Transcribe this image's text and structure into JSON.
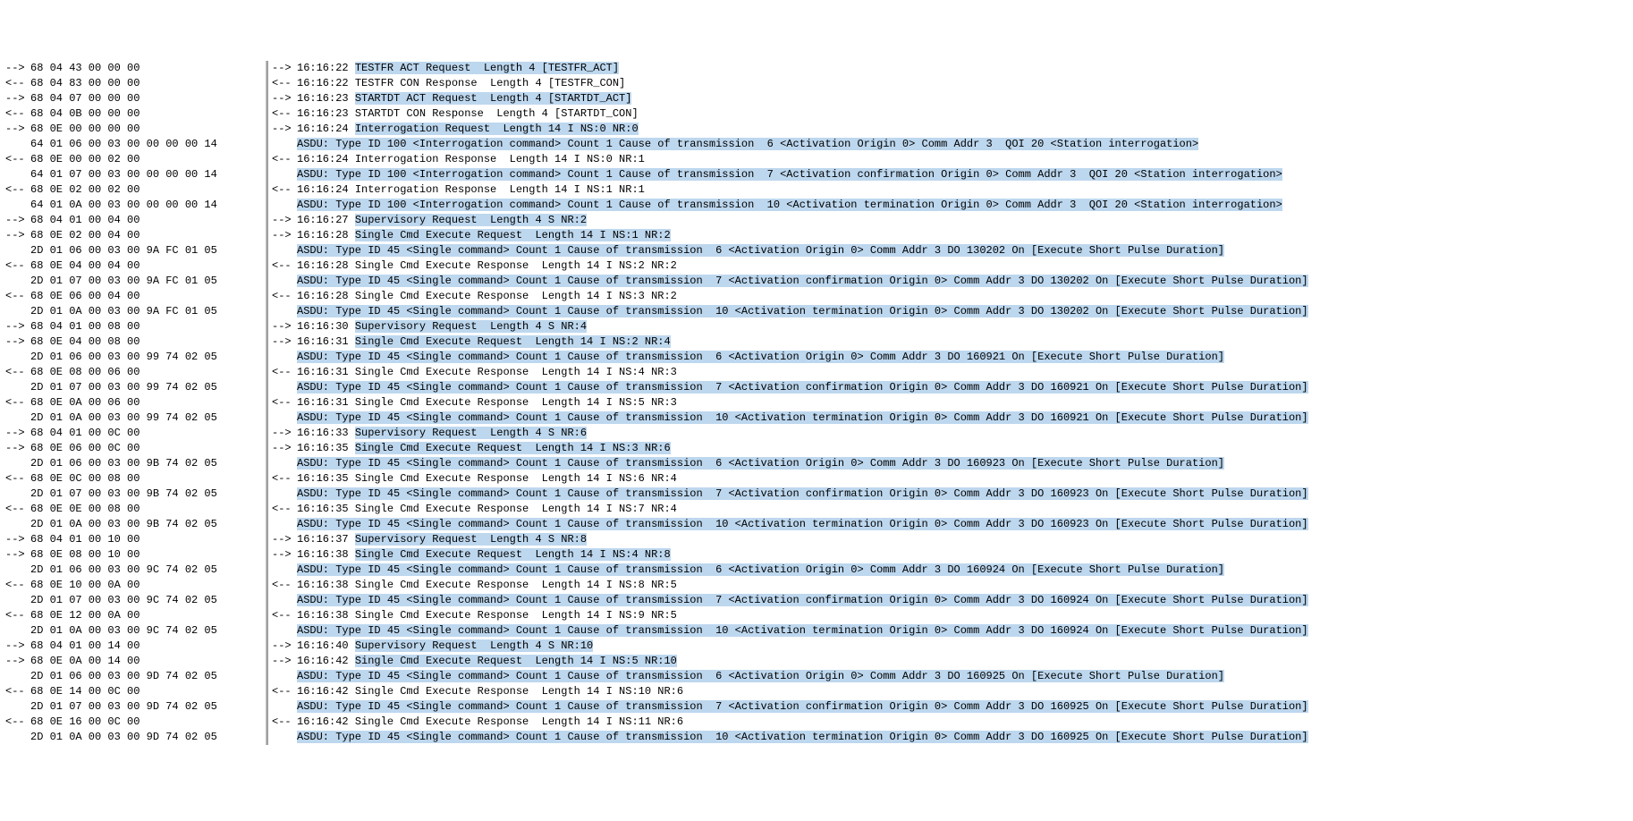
{
  "left": [
    {
      "dir": "-->",
      "hex": "68 04 43 00 00 00"
    },
    {
      "dir": "<--",
      "hex": "68 04 83 00 00 00"
    },
    {
      "dir": "-->",
      "hex": "68 04 07 00 00 00"
    },
    {
      "dir": "<--",
      "hex": "68 04 0B 00 00 00"
    },
    {
      "dir": "-->",
      "hex": "68 0E 00 00 00 00"
    },
    {
      "dir": "   ",
      "hex": "64 01 06 00 03 00 00 00 00 14"
    },
    {
      "dir": "<--",
      "hex": "68 0E 00 00 02 00"
    },
    {
      "dir": "   ",
      "hex": "64 01 07 00 03 00 00 00 00 14"
    },
    {
      "dir": "<--",
      "hex": "68 0E 02 00 02 00"
    },
    {
      "dir": "   ",
      "hex": "64 01 0A 00 03 00 00 00 00 14"
    },
    {
      "dir": "-->",
      "hex": "68 04 01 00 04 00"
    },
    {
      "dir": "-->",
      "hex": "68 0E 02 00 04 00"
    },
    {
      "dir": "   ",
      "hex": "2D 01 06 00 03 00 9A FC 01 05"
    },
    {
      "dir": "<--",
      "hex": "68 0E 04 00 04 00"
    },
    {
      "dir": "   ",
      "hex": "2D 01 07 00 03 00 9A FC 01 05"
    },
    {
      "dir": "<--",
      "hex": "68 0E 06 00 04 00"
    },
    {
      "dir": "   ",
      "hex": "2D 01 0A 00 03 00 9A FC 01 05"
    },
    {
      "dir": "-->",
      "hex": "68 04 01 00 08 00"
    },
    {
      "dir": "-->",
      "hex": "68 0E 04 00 08 00"
    },
    {
      "dir": "   ",
      "hex": "2D 01 06 00 03 00 99 74 02 05"
    },
    {
      "dir": "<--",
      "hex": "68 0E 08 00 06 00"
    },
    {
      "dir": "   ",
      "hex": "2D 01 07 00 03 00 99 74 02 05"
    },
    {
      "dir": "<--",
      "hex": "68 0E 0A 00 06 00"
    },
    {
      "dir": "   ",
      "hex": "2D 01 0A 00 03 00 99 74 02 05"
    },
    {
      "dir": "-->",
      "hex": "68 04 01 00 0C 00"
    },
    {
      "dir": "-->",
      "hex": "68 0E 06 00 0C 00"
    },
    {
      "dir": "   ",
      "hex": "2D 01 06 00 03 00 9B 74 02 05"
    },
    {
      "dir": "<--",
      "hex": "68 0E 0C 00 08 00"
    },
    {
      "dir": "   ",
      "hex": "2D 01 07 00 03 00 9B 74 02 05"
    },
    {
      "dir": "<--",
      "hex": "68 0E 0E 00 08 00"
    },
    {
      "dir": "   ",
      "hex": "2D 01 0A 00 03 00 9B 74 02 05"
    },
    {
      "dir": "-->",
      "hex": "68 04 01 00 10 00"
    },
    {
      "dir": "-->",
      "hex": "68 0E 08 00 10 00"
    },
    {
      "dir": "   ",
      "hex": "2D 01 06 00 03 00 9C 74 02 05"
    },
    {
      "dir": "<--",
      "hex": "68 0E 10 00 0A 00"
    },
    {
      "dir": "   ",
      "hex": "2D 01 07 00 03 00 9C 74 02 05"
    },
    {
      "dir": "<--",
      "hex": "68 0E 12 00 0A 00"
    },
    {
      "dir": "   ",
      "hex": "2D 01 0A 00 03 00 9C 74 02 05"
    },
    {
      "dir": "-->",
      "hex": "68 04 01 00 14 00"
    },
    {
      "dir": "-->",
      "hex": "68 0E 0A 00 14 00"
    },
    {
      "dir": "   ",
      "hex": "2D 01 06 00 03 00 9D 74 02 05"
    },
    {
      "dir": "<--",
      "hex": "68 0E 14 00 0C 00"
    },
    {
      "dir": "   ",
      "hex": "2D 01 07 00 03 00 9D 74 02 05"
    },
    {
      "dir": "<--",
      "hex": "68 0E 16 00 0C 00"
    },
    {
      "dir": "   ",
      "hex": "2D 01 0A 00 03 00 9D 74 02 05"
    }
  ],
  "right": [
    {
      "dir": "-->",
      "time": "16:16:22",
      "plain": "",
      "hl": "TESTFR ACT Request  Length 4 [TESTFR_ACT]"
    },
    {
      "dir": "<--",
      "time": "16:16:22",
      "plain": "TESTFR CON Response  Length 4 [TESTFR_CON]",
      "hl": ""
    },
    {
      "dir": "-->",
      "time": "16:16:23",
      "plain": "",
      "hl": "STARTDT ACT Request  Length 4 [STARTDT_ACT]"
    },
    {
      "dir": "<--",
      "time": "16:16:23",
      "plain": "STARTDT CON Response  Length 4 [STARTDT_CON]",
      "hl": ""
    },
    {
      "dir": "-->",
      "time": "16:16:24",
      "plain": "",
      "hl": "Interrogation Request  Length 14 I NS:0 NR:0"
    },
    {
      "dir": "   ",
      "time": "",
      "plain": "",
      "hl": "ASDU: Type ID 100 <Interrogation command> Count 1 Cause of transmission  6 <Activation Origin 0> Comm Addr 3  QOI 20 <Station interrogation>"
    },
    {
      "dir": "<--",
      "time": "16:16:24",
      "plain": "Interrogation Response  Length 14 I NS:0 NR:1",
      "hl": ""
    },
    {
      "dir": "   ",
      "time": "",
      "plain": "",
      "hl": "ASDU: Type ID 100 <Interrogation command> Count 1 Cause of transmission  7 <Activation confirmation Origin 0> Comm Addr 3  QOI 20 <Station interrogation>"
    },
    {
      "dir": "<--",
      "time": "16:16:24",
      "plain": "Interrogation Response  Length 14 I NS:1 NR:1",
      "hl": ""
    },
    {
      "dir": "   ",
      "time": "",
      "plain": "",
      "hl": "ASDU: Type ID 100 <Interrogation command> Count 1 Cause of transmission  10 <Activation termination Origin 0> Comm Addr 3  QOI 20 <Station interrogation>"
    },
    {
      "dir": "-->",
      "time": "16:16:27",
      "plain": "",
      "hl": "Supervisory Request  Length 4 S NR:2"
    },
    {
      "dir": "-->",
      "time": "16:16:28",
      "plain": "",
      "hl": "Single Cmd Execute Request  Length 14 I NS:1 NR:2"
    },
    {
      "dir": "   ",
      "time": "",
      "plain": "",
      "hl": "ASDU: Type ID 45 <Single command> Count 1 Cause of transmission  6 <Activation Origin 0> Comm Addr 3 DO 130202 On [Execute Short Pulse Duration]"
    },
    {
      "dir": "<--",
      "time": "16:16:28",
      "plain": "Single Cmd Execute Response  Length 14 I NS:2 NR:2",
      "hl": ""
    },
    {
      "dir": "   ",
      "time": "",
      "plain": "",
      "hl": "ASDU: Type ID 45 <Single command> Count 1 Cause of transmission  7 <Activation confirmation Origin 0> Comm Addr 3 DO 130202 On [Execute Short Pulse Duration]"
    },
    {
      "dir": "<--",
      "time": "16:16:28",
      "plain": "Single Cmd Execute Response  Length 14 I NS:3 NR:2",
      "hl": ""
    },
    {
      "dir": "   ",
      "time": "",
      "plain": "",
      "hl": "ASDU: Type ID 45 <Single command> Count 1 Cause of transmission  10 <Activation termination Origin 0> Comm Addr 3 DO 130202 On [Execute Short Pulse Duration]"
    },
    {
      "dir": "-->",
      "time": "16:16:30",
      "plain": "",
      "hl": "Supervisory Request  Length 4 S NR:4"
    },
    {
      "dir": "-->",
      "time": "16:16:31",
      "plain": "",
      "hl": "Single Cmd Execute Request  Length 14 I NS:2 NR:4"
    },
    {
      "dir": "   ",
      "time": "",
      "plain": "",
      "hl": "ASDU: Type ID 45 <Single command> Count 1 Cause of transmission  6 <Activation Origin 0> Comm Addr 3 DO 160921 On [Execute Short Pulse Duration]"
    },
    {
      "dir": "<--",
      "time": "16:16:31",
      "plain": "Single Cmd Execute Response  Length 14 I NS:4 NR:3",
      "hl": ""
    },
    {
      "dir": "   ",
      "time": "",
      "plain": "",
      "hl": "ASDU: Type ID 45 <Single command> Count 1 Cause of transmission  7 <Activation confirmation Origin 0> Comm Addr 3 DO 160921 On [Execute Short Pulse Duration]"
    },
    {
      "dir": "<--",
      "time": "16:16:31",
      "plain": "Single Cmd Execute Response  Length 14 I NS:5 NR:3",
      "hl": ""
    },
    {
      "dir": "   ",
      "time": "",
      "plain": "",
      "hl": "ASDU: Type ID 45 <Single command> Count 1 Cause of transmission  10 <Activation termination Origin 0> Comm Addr 3 DO 160921 On [Execute Short Pulse Duration]"
    },
    {
      "dir": "-->",
      "time": "16:16:33",
      "plain": "",
      "hl": "Supervisory Request  Length 4 S NR:6"
    },
    {
      "dir": "-->",
      "time": "16:16:35",
      "plain": "",
      "hl": "Single Cmd Execute Request  Length 14 I NS:3 NR:6"
    },
    {
      "dir": "   ",
      "time": "",
      "plain": "",
      "hl": "ASDU: Type ID 45 <Single command> Count 1 Cause of transmission  6 <Activation Origin 0> Comm Addr 3 DO 160923 On [Execute Short Pulse Duration]"
    },
    {
      "dir": "<--",
      "time": "16:16:35",
      "plain": "Single Cmd Execute Response  Length 14 I NS:6 NR:4",
      "hl": ""
    },
    {
      "dir": "   ",
      "time": "",
      "plain": "",
      "hl": "ASDU: Type ID 45 <Single command> Count 1 Cause of transmission  7 <Activation confirmation Origin 0> Comm Addr 3 DO 160923 On [Execute Short Pulse Duration]"
    },
    {
      "dir": "<--",
      "time": "16:16:35",
      "plain": "Single Cmd Execute Response  Length 14 I NS:7 NR:4",
      "hl": ""
    },
    {
      "dir": "   ",
      "time": "",
      "plain": "",
      "hl": "ASDU: Type ID 45 <Single command> Count 1 Cause of transmission  10 <Activation termination Origin 0> Comm Addr 3 DO 160923 On [Execute Short Pulse Duration]"
    },
    {
      "dir": "-->",
      "time": "16:16:37",
      "plain": "",
      "hl": "Supervisory Request  Length 4 S NR:8"
    },
    {
      "dir": "-->",
      "time": "16:16:38",
      "plain": "",
      "hl": "Single Cmd Execute Request  Length 14 I NS:4 NR:8"
    },
    {
      "dir": "   ",
      "time": "",
      "plain": "",
      "hl": "ASDU: Type ID 45 <Single command> Count 1 Cause of transmission  6 <Activation Origin 0> Comm Addr 3 DO 160924 On [Execute Short Pulse Duration]"
    },
    {
      "dir": "<--",
      "time": "16:16:38",
      "plain": "Single Cmd Execute Response  Length 14 I NS:8 NR:5",
      "hl": ""
    },
    {
      "dir": "   ",
      "time": "",
      "plain": "",
      "hl": "ASDU: Type ID 45 <Single command> Count 1 Cause of transmission  7 <Activation confirmation Origin 0> Comm Addr 3 DO 160924 On [Execute Short Pulse Duration]"
    },
    {
      "dir": "<--",
      "time": "16:16:38",
      "plain": "Single Cmd Execute Response  Length 14 I NS:9 NR:5",
      "hl": ""
    },
    {
      "dir": "   ",
      "time": "",
      "plain": "",
      "hl": "ASDU: Type ID 45 <Single command> Count 1 Cause of transmission  10 <Activation termination Origin 0> Comm Addr 3 DO 160924 On [Execute Short Pulse Duration]"
    },
    {
      "dir": "-->",
      "time": "16:16:40",
      "plain": "",
      "hl": "Supervisory Request  Length 4 S NR:10"
    },
    {
      "dir": "-->",
      "time": "16:16:42",
      "plain": "",
      "hl": "Single Cmd Execute Request  Length 14 I NS:5 NR:10"
    },
    {
      "dir": "   ",
      "time": "",
      "plain": "",
      "hl": "ASDU: Type ID 45 <Single command> Count 1 Cause of transmission  6 <Activation Origin 0> Comm Addr 3 DO 160925 On [Execute Short Pulse Duration]"
    },
    {
      "dir": "<--",
      "time": "16:16:42",
      "plain": "Single Cmd Execute Response  Length 14 I NS:10 NR:6",
      "hl": ""
    },
    {
      "dir": "   ",
      "time": "",
      "plain": "",
      "hl": "ASDU: Type ID 45 <Single command> Count 1 Cause of transmission  7 <Activation confirmation Origin 0> Comm Addr 3 DO 160925 On [Execute Short Pulse Duration]"
    },
    {
      "dir": "<--",
      "time": "16:16:42",
      "plain": "Single Cmd Execute Response  Length 14 I NS:11 NR:6",
      "hl": ""
    },
    {
      "dir": "   ",
      "time": "",
      "plain": "",
      "hl": "ASDU: Type ID 45 <Single command> Count 1 Cause of transmission  10 <Activation termination Origin 0> Comm Addr 3 DO 160925 On [Execute Short Pulse Duration]"
    }
  ]
}
